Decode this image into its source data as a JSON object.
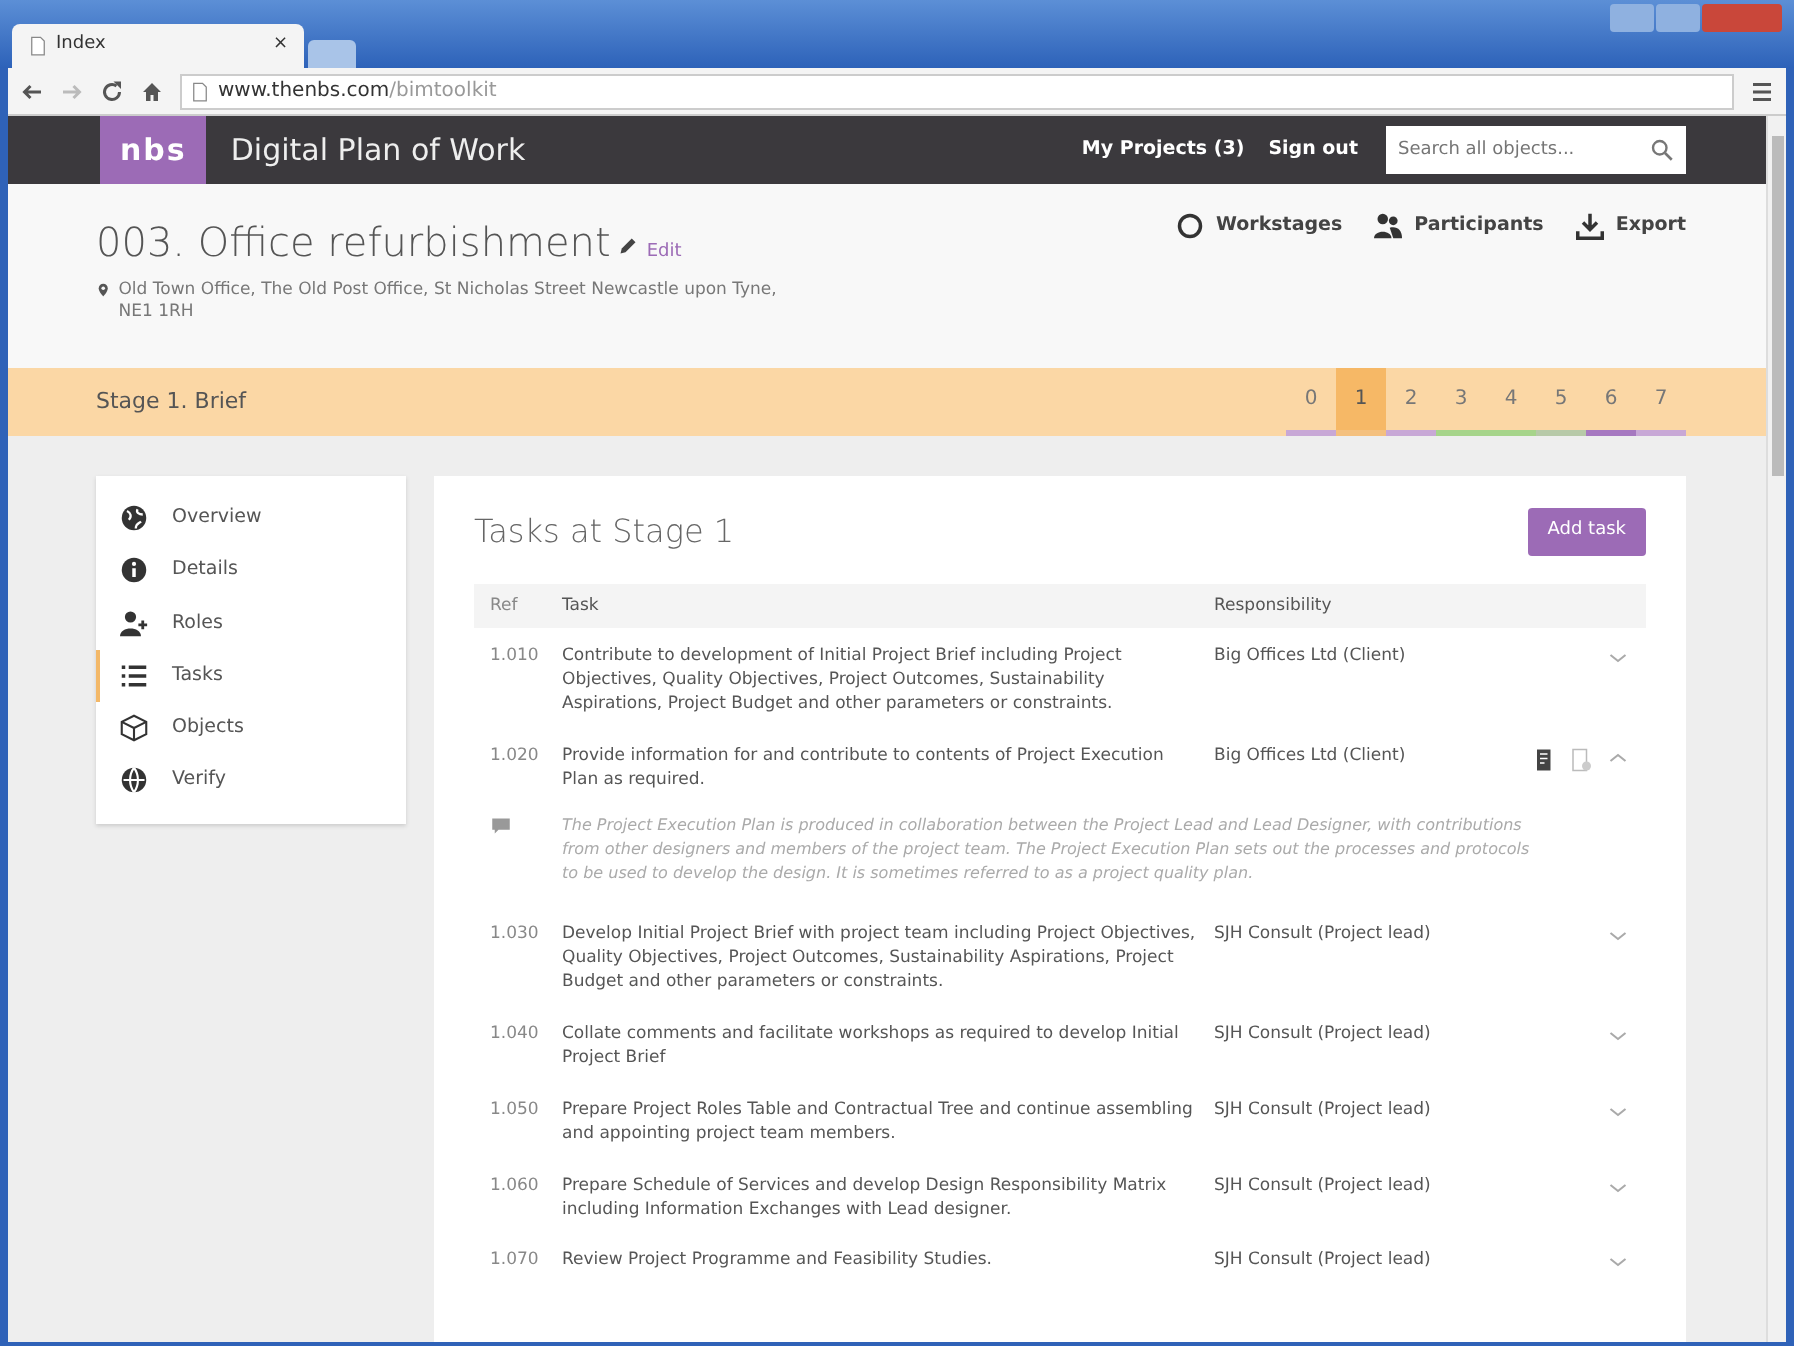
{
  "browser": {
    "tab_title": "Index",
    "tab_close": "×",
    "url_host": "www.thenbs.com",
    "url_path": "/bimtoolkit"
  },
  "navbar": {
    "logo": "nbs",
    "title": "Digital Plan of Work",
    "links": [
      "My Projects (3)",
      "Sign out"
    ],
    "search": {
      "placeholder": "Search all objects..."
    }
  },
  "project": {
    "title": "003. Office refurbishment",
    "edit": "Edit",
    "address": "Old Town Office, The Old Post Office, St Nicholas Street Newcastle upon Tyne, NE1 1RH",
    "actions": [
      {
        "kind": "workstages",
        "label": "Workstages"
      },
      {
        "kind": "participants",
        "label": "Participants"
      },
      {
        "kind": "export",
        "label": "Export"
      }
    ]
  },
  "stage_bar": {
    "title": "Stage 1. Brief",
    "stages": [
      {
        "label": "0",
        "selected": false,
        "color": "#c8a8d6"
      },
      {
        "label": "1",
        "selected": true,
        "color": "#f4c07e"
      },
      {
        "label": "2",
        "selected": false,
        "color": "#c8a8d6"
      },
      {
        "label": "3",
        "selected": false,
        "color": "#a6d48a"
      },
      {
        "label": "4",
        "selected": false,
        "color": "#a6d48a"
      },
      {
        "label": "5",
        "selected": false,
        "color": "#b7c9a8"
      },
      {
        "label": "6",
        "selected": false,
        "color": "#a678c0"
      },
      {
        "label": "7",
        "selected": false,
        "color": "#c8a8d6"
      }
    ]
  },
  "sidebar": {
    "items": [
      {
        "kind": "globe",
        "label": "Overview",
        "selected": false
      },
      {
        "kind": "info",
        "label": "Details",
        "selected": false
      },
      {
        "kind": "user-plus",
        "label": "Roles",
        "selected": false
      },
      {
        "kind": "list",
        "label": "Tasks",
        "selected": true
      },
      {
        "kind": "cube",
        "label": "Objects",
        "selected": false
      },
      {
        "kind": "check-globe",
        "label": "Verify",
        "selected": false
      }
    ]
  },
  "tasks": {
    "title": "Tasks at Stage 1",
    "add_button": "Add task",
    "columns": [
      "Ref",
      "Task",
      "Responsibility"
    ],
    "rows": [
      {
        "ref": "1.010",
        "task": "Contribute to development of Initial Project Brief including Project Objectives, Quality Objectives, Project Outcomes, Sustainability Aspirations, Project Budget and other parameters or constraints.",
        "responsibility": "Big Offices Ltd (Client)",
        "expanded": false
      },
      {
        "ref": "1.020",
        "task": "Provide information for and contribute to contents of Project Execution Plan as required.",
        "responsibility": "Big Offices Ltd (Client)",
        "expanded": true,
        "note": "The Project Execution Plan is produced in collaboration between the Project Lead and Lead Designer, with contributions from other designers and members of the project team. The Project Execution Plan sets out the processes and protocols to be used to develop the design. It is sometimes referred to as a project quality plan."
      },
      {
        "ref": "1.030",
        "task": "Develop Initial Project Brief with project team including Project Objectives, Quality Objectives, Project Outcomes, Sustainability Aspirations, Project Budget and other parameters or constraints.",
        "responsibility": "SJH Consult (Project lead)",
        "expanded": false
      },
      {
        "ref": "1.040",
        "task": "Collate comments and facilitate workshops as required to develop Initial Project Brief",
        "responsibility": "SJH Consult (Project lead)",
        "expanded": false
      },
      {
        "ref": "1.050",
        "task": "Prepare Project Roles Table and Contractual Tree and continue assembling and appointing project team members.",
        "responsibility": "SJH Consult (Project lead)",
        "expanded": false
      },
      {
        "ref": "1.060",
        "task": "Prepare Schedule of Services and develop Design Responsibility Matrix including Information Exchanges with Lead designer.",
        "responsibility": "SJH Consult (Project lead)",
        "expanded": false
      },
      {
        "ref": "1.070",
        "task": "Review Project Programme and Feasibility Studies.",
        "responsibility": "SJH Consult (Project lead)",
        "expanded": false
      }
    ]
  }
}
